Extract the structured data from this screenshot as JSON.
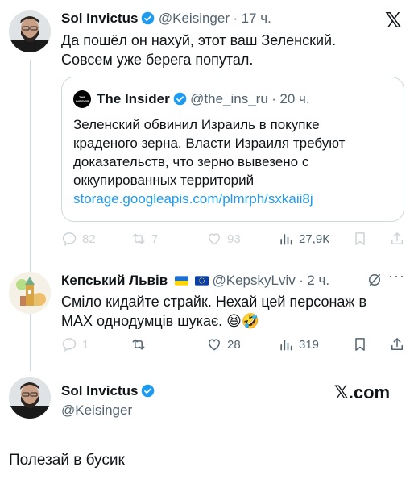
{
  "tweet1": {
    "author_name": "Sol Invictus",
    "handle": "@Keisinger",
    "time": "17 ч.",
    "text_line1": "Да пошёл он нахуй, этот ваш Зеленский.",
    "text_line2": "Совсем уже берега попутал."
  },
  "quote": {
    "logo_text": "THE INSIDER",
    "author_name": "The Insider",
    "handle": "@the_ins_ru",
    "time": "20 ч.",
    "lines": [
      "Зеленский обвинил Израиль в покупке",
      "краденого зерна. Власти Израиля требуют",
      "доказательств, что зерно вывезено с",
      "оккупированных территорий"
    ],
    "link": "storage.googleapis.com/plmrph/sxkaii8j"
  },
  "tweet1_actions": {
    "replies": "82",
    "reposts": "7",
    "likes": "93",
    "views": "27,9К"
  },
  "reply": {
    "author_name": "Кепський Львів",
    "handle": "@KepskyLviv",
    "time": "2 ч.",
    "text_line1": "Сміло кидайте страйк. Нехай цей персонаж в",
    "text_line2": "MAX однодумців шукає. 😆🤣",
    "actions": {
      "replies": "1",
      "likes": "28",
      "views": "319"
    }
  },
  "card": {
    "author_name": "Sol Invictus",
    "handle": "@Keisinger",
    "brand": "𝕏.com",
    "text": "Полезай в бусик"
  },
  "header": {
    "x_logo": "𝕏"
  },
  "colors": {
    "verified": "#1d9bf0",
    "link": "#1d9bf0",
    "muted": "#536471",
    "border": "#cfd9de"
  }
}
